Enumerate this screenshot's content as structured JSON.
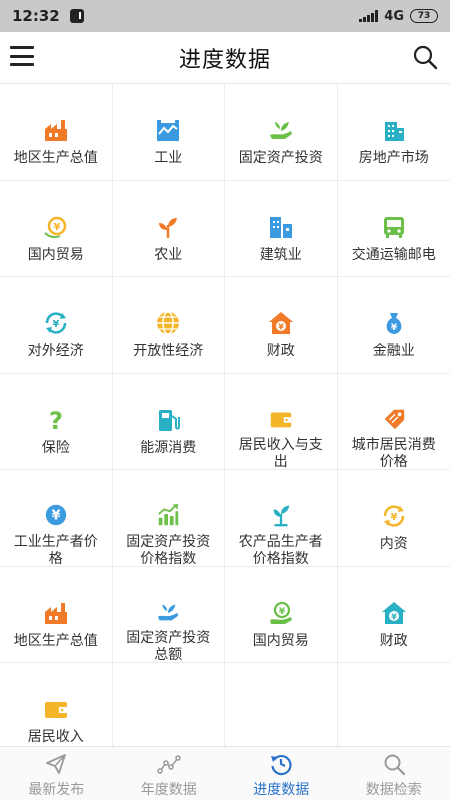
{
  "status": {
    "time": "12:32",
    "network": "4G",
    "battery": "73"
  },
  "header": {
    "title": "进度数据"
  },
  "grid": [
    {
      "label": "地区生产总值",
      "icon": "factory-icon",
      "color": "#f07a28"
    },
    {
      "label": "工业",
      "icon": "industry-icon",
      "color": "#3c9be0"
    },
    {
      "label": "固定资产投资",
      "icon": "hand-plant-icon",
      "color": "#6cc04a"
    },
    {
      "label": "房地产市场",
      "icon": "building-icon",
      "color": "#29b0c4"
    },
    {
      "label": "国内贸易",
      "icon": "coin-trade-icon",
      "color": "#f5b52a"
    },
    {
      "label": "农业",
      "icon": "sprout-icon",
      "color": "#f07a28"
    },
    {
      "label": "建筑业",
      "icon": "city-buildings-icon",
      "color": "#3c9be0"
    },
    {
      "label": "交通运输邮电",
      "icon": "bus-icon",
      "color": "#6cc04a"
    },
    {
      "label": "对外经济",
      "icon": "yuan-exchange-icon",
      "color": "#29b0c4"
    },
    {
      "label": "开放性经济",
      "icon": "globe-icon",
      "color": "#f5b52a"
    },
    {
      "label": "财政",
      "icon": "house-yuan-icon",
      "color": "#f07a28"
    },
    {
      "label": "金融业",
      "icon": "money-bag-icon",
      "color": "#3c9be0"
    },
    {
      "label": "保险",
      "icon": "question-icon",
      "color": "#6cc04a"
    },
    {
      "label": "能源消费",
      "icon": "fuel-pump-icon",
      "color": "#29b0c4"
    },
    {
      "label": "居民收入与支出",
      "icon": "wallet-icon",
      "color": "#f5b52a"
    },
    {
      "label": "城市居民消费价格",
      "icon": "price-tag-icon",
      "color": "#f07a28"
    },
    {
      "label": "工业生产者价格",
      "icon": "yuan-circle-icon",
      "color": "#3c9be0"
    },
    {
      "label": "固定资产投资价格指数",
      "icon": "bar-trend-icon",
      "color": "#6cc04a"
    },
    {
      "label": "农产品生产者价格指数",
      "icon": "plant-hand-icon",
      "color": "#29b0c4"
    },
    {
      "label": "内资",
      "icon": "yuan-exchange-icon",
      "color": "#f5b52a"
    },
    {
      "label": "地区生产总值",
      "icon": "factory-icon",
      "color": "#f07a28"
    },
    {
      "label": "固定资产投资总额",
      "icon": "hand-plant-icon",
      "color": "#3c9be0"
    },
    {
      "label": "国内贸易",
      "icon": "yuan-hand-icon",
      "color": "#6cc04a"
    },
    {
      "label": "财政",
      "icon": "house-yuan-icon",
      "color": "#29b0c4"
    },
    {
      "label": "居民收入",
      "icon": "wallet-icon",
      "color": "#f5b52a"
    }
  ],
  "tabs": [
    {
      "label": "最新发布",
      "icon": "paper-plane-icon",
      "active": false
    },
    {
      "label": "年度数据",
      "icon": "line-nodes-icon",
      "active": false
    },
    {
      "label": "进度数据",
      "icon": "clock-history-icon",
      "active": true
    },
    {
      "label": "数据检索",
      "icon": "search-icon",
      "active": false
    }
  ]
}
